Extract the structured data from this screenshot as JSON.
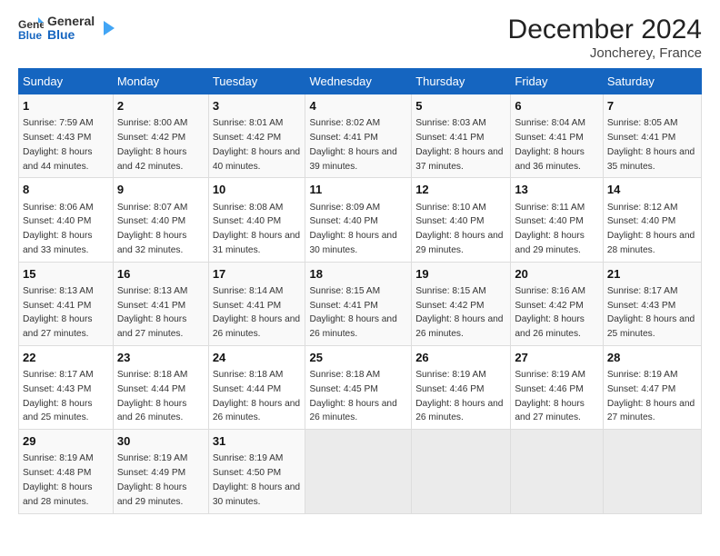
{
  "header": {
    "logo_general": "General",
    "logo_blue": "Blue",
    "title": "December 2024",
    "location": "Joncherey, France"
  },
  "weekdays": [
    "Sunday",
    "Monday",
    "Tuesday",
    "Wednesday",
    "Thursday",
    "Friday",
    "Saturday"
  ],
  "weeks": [
    [
      {
        "day": "1",
        "sunrise": "7:59 AM",
        "sunset": "4:43 PM",
        "daylight": "8 hours and 44 minutes."
      },
      {
        "day": "2",
        "sunrise": "8:00 AM",
        "sunset": "4:42 PM",
        "daylight": "8 hours and 42 minutes."
      },
      {
        "day": "3",
        "sunrise": "8:01 AM",
        "sunset": "4:42 PM",
        "daylight": "8 hours and 40 minutes."
      },
      {
        "day": "4",
        "sunrise": "8:02 AM",
        "sunset": "4:41 PM",
        "daylight": "8 hours and 39 minutes."
      },
      {
        "day": "5",
        "sunrise": "8:03 AM",
        "sunset": "4:41 PM",
        "daylight": "8 hours and 37 minutes."
      },
      {
        "day": "6",
        "sunrise": "8:04 AM",
        "sunset": "4:41 PM",
        "daylight": "8 hours and 36 minutes."
      },
      {
        "day": "7",
        "sunrise": "8:05 AM",
        "sunset": "4:41 PM",
        "daylight": "8 hours and 35 minutes."
      }
    ],
    [
      {
        "day": "8",
        "sunrise": "8:06 AM",
        "sunset": "4:40 PM",
        "daylight": "8 hours and 33 minutes."
      },
      {
        "day": "9",
        "sunrise": "8:07 AM",
        "sunset": "4:40 PM",
        "daylight": "8 hours and 32 minutes."
      },
      {
        "day": "10",
        "sunrise": "8:08 AM",
        "sunset": "4:40 PM",
        "daylight": "8 hours and 31 minutes."
      },
      {
        "day": "11",
        "sunrise": "8:09 AM",
        "sunset": "4:40 PM",
        "daylight": "8 hours and 30 minutes."
      },
      {
        "day": "12",
        "sunrise": "8:10 AM",
        "sunset": "4:40 PM",
        "daylight": "8 hours and 29 minutes."
      },
      {
        "day": "13",
        "sunrise": "8:11 AM",
        "sunset": "4:40 PM",
        "daylight": "8 hours and 29 minutes."
      },
      {
        "day": "14",
        "sunrise": "8:12 AM",
        "sunset": "4:40 PM",
        "daylight": "8 hours and 28 minutes."
      }
    ],
    [
      {
        "day": "15",
        "sunrise": "8:13 AM",
        "sunset": "4:41 PM",
        "daylight": "8 hours and 27 minutes."
      },
      {
        "day": "16",
        "sunrise": "8:13 AM",
        "sunset": "4:41 PM",
        "daylight": "8 hours and 27 minutes."
      },
      {
        "day": "17",
        "sunrise": "8:14 AM",
        "sunset": "4:41 PM",
        "daylight": "8 hours and 26 minutes."
      },
      {
        "day": "18",
        "sunrise": "8:15 AM",
        "sunset": "4:41 PM",
        "daylight": "8 hours and 26 minutes."
      },
      {
        "day": "19",
        "sunrise": "8:15 AM",
        "sunset": "4:42 PM",
        "daylight": "8 hours and 26 minutes."
      },
      {
        "day": "20",
        "sunrise": "8:16 AM",
        "sunset": "4:42 PM",
        "daylight": "8 hours and 26 minutes."
      },
      {
        "day": "21",
        "sunrise": "8:17 AM",
        "sunset": "4:43 PM",
        "daylight": "8 hours and 25 minutes."
      }
    ],
    [
      {
        "day": "22",
        "sunrise": "8:17 AM",
        "sunset": "4:43 PM",
        "daylight": "8 hours and 25 minutes."
      },
      {
        "day": "23",
        "sunrise": "8:18 AM",
        "sunset": "4:44 PM",
        "daylight": "8 hours and 26 minutes."
      },
      {
        "day": "24",
        "sunrise": "8:18 AM",
        "sunset": "4:44 PM",
        "daylight": "8 hours and 26 minutes."
      },
      {
        "day": "25",
        "sunrise": "8:18 AM",
        "sunset": "4:45 PM",
        "daylight": "8 hours and 26 minutes."
      },
      {
        "day": "26",
        "sunrise": "8:19 AM",
        "sunset": "4:46 PM",
        "daylight": "8 hours and 26 minutes."
      },
      {
        "day": "27",
        "sunrise": "8:19 AM",
        "sunset": "4:46 PM",
        "daylight": "8 hours and 27 minutes."
      },
      {
        "day": "28",
        "sunrise": "8:19 AM",
        "sunset": "4:47 PM",
        "daylight": "8 hours and 27 minutes."
      }
    ],
    [
      {
        "day": "29",
        "sunrise": "8:19 AM",
        "sunset": "4:48 PM",
        "daylight": "8 hours and 28 minutes."
      },
      {
        "day": "30",
        "sunrise": "8:19 AM",
        "sunset": "4:49 PM",
        "daylight": "8 hours and 29 minutes."
      },
      {
        "day": "31",
        "sunrise": "8:19 AM",
        "sunset": "4:50 PM",
        "daylight": "8 hours and 30 minutes."
      },
      null,
      null,
      null,
      null
    ]
  ]
}
